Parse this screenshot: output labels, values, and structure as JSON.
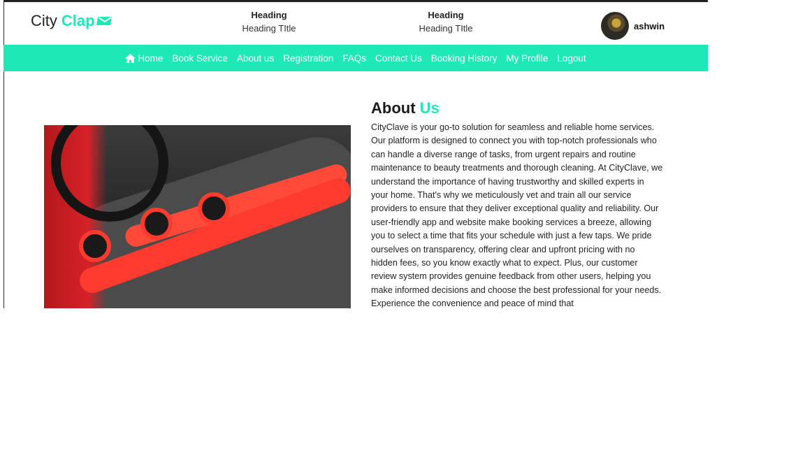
{
  "brand": {
    "city": "City",
    "clap": "Clap"
  },
  "header": {
    "blocks": [
      {
        "heading": "Heading",
        "title": "Heading TItle"
      },
      {
        "heading": "Heading",
        "title": "Heading TItle"
      }
    ],
    "user": {
      "name": "ashwin"
    }
  },
  "nav": {
    "items": [
      {
        "label": "Home",
        "icon": "home-icon"
      },
      {
        "label": "Book Service"
      },
      {
        "label": "About us"
      },
      {
        "label": "Registration"
      },
      {
        "label": "FAQs"
      },
      {
        "label": "Contact Us"
      },
      {
        "label": "Booking History"
      },
      {
        "label": "My Profile"
      },
      {
        "label": "Logout"
      }
    ]
  },
  "about": {
    "title_a": "About",
    "title_b": "Us",
    "paragraph": "CityClave is your go-to solution for seamless and reliable home services. Our platform is designed to connect you with top-notch professionals who can handle a diverse range of tasks, from urgent repairs and routine maintenance to beauty treatments and thorough cleaning. At CityClave, we understand the importance of having trustworthy and skilled experts in your home. That's why we meticulously vet and train all our service providers to ensure that they deliver exceptional quality and reliability. Our user-friendly app and website make booking services a breeze, allowing you to select a time that fits your schedule with just a few taps. We pride ourselves on transparency, offering clear and upfront pricing with no hidden fees, so you know exactly what to expect. Plus, our customer review system provides genuine feedback from other users, helping you make informed decisions and choose the best professional for your needs. Experience the convenience and peace of mind that"
  },
  "colors": {
    "accent": "#1de9b6",
    "nav_text": "#ffffff"
  }
}
